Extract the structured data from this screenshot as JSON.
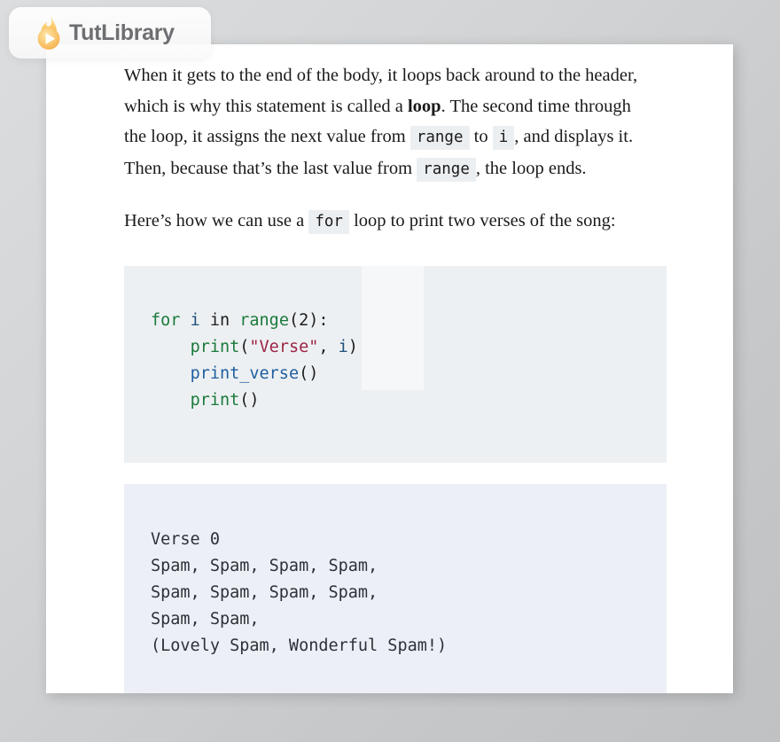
{
  "brand": {
    "name": "TutLibrary",
    "logo_icon": "flame-play-icon",
    "flame_color_outer": "#f6b83f",
    "flame_color_inner": "#fde4a0",
    "text_color": "#6d6e71"
  },
  "article": {
    "paragraphs": [
      {
        "id": "p1",
        "runs": [
          {
            "type": "text",
            "text": "When it gets to the end of the body, it loops back around to the header, which is why this statement is called a "
          },
          {
            "type": "bold",
            "text": "loop"
          },
          {
            "type": "text",
            "text": ". The second time through the loop, it assigns the next value from "
          },
          {
            "type": "code",
            "text": "range"
          },
          {
            "type": "text",
            "text": " to "
          },
          {
            "type": "code",
            "text": "i"
          },
          {
            "type": "text",
            "text": ", and displays it. Then, because that’s the last value from "
          },
          {
            "type": "code",
            "text": "range"
          },
          {
            "type": "text",
            "text": ", the loop ends."
          }
        ]
      },
      {
        "id": "p2",
        "runs": [
          {
            "type": "text",
            "text": "Here’s how we can use a "
          },
          {
            "type": "code",
            "text": "for"
          },
          {
            "type": "text",
            "text": " loop to print two verses of the song:"
          }
        ]
      }
    ],
    "code_block": {
      "language": "python",
      "background": "#edf0f2",
      "lines": [
        [
          {
            "t": "for",
            "c": "kw"
          },
          {
            "t": " ",
            "c": "plain"
          },
          {
            "t": "i",
            "c": "name"
          },
          {
            "t": " in ",
            "c": "plain"
          },
          {
            "t": "range",
            "c": "fn"
          },
          {
            "t": "(",
            "c": "plain"
          },
          {
            "t": "2",
            "c": "num"
          },
          {
            "t": "):",
            "c": "plain"
          }
        ],
        [
          {
            "t": "    ",
            "c": "plain"
          },
          {
            "t": "print",
            "c": "fn"
          },
          {
            "t": "(",
            "c": "plain"
          },
          {
            "t": "\"Verse\"",
            "c": "str"
          },
          {
            "t": ", ",
            "c": "plain"
          },
          {
            "t": "i",
            "c": "name"
          },
          {
            "t": ")",
            "c": "plain"
          }
        ],
        [
          {
            "t": "    ",
            "c": "plain"
          },
          {
            "t": "print_verse",
            "c": "def"
          },
          {
            "t": "()",
            "c": "plain"
          }
        ],
        [
          {
            "t": "    ",
            "c": "plain"
          },
          {
            "t": "print",
            "c": "fn"
          },
          {
            "t": "()",
            "c": "plain"
          }
        ]
      ]
    },
    "output_block": {
      "background": "#edeff6",
      "text": "Verse 0\nSpam, Spam, Spam, Spam,\nSpam, Spam, Spam, Spam,\nSpam, Spam,\n(Lovely Spam, Wonderful Spam!)"
    }
  }
}
